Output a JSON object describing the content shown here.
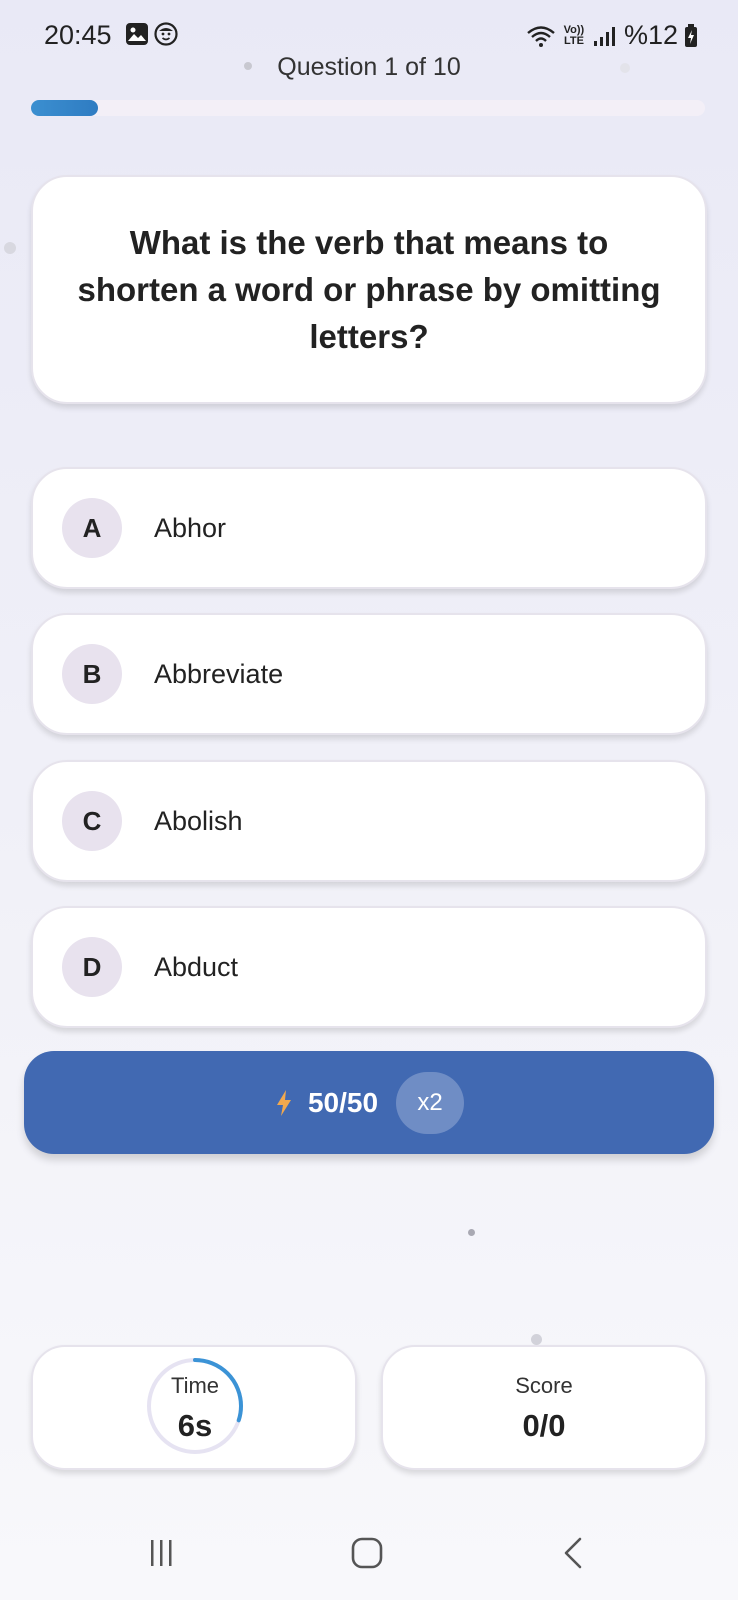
{
  "status_bar": {
    "time": "20:45",
    "network": "Vo)) LTE",
    "battery": "%12"
  },
  "quiz": {
    "counter": "Question 1 of 10",
    "progress": 0.1,
    "question": "What is the verb that means to shorten a word or phrase by omitting letters?",
    "options": [
      {
        "letter": "A",
        "text": "Abhor"
      },
      {
        "letter": "B",
        "text": "Abbreviate"
      },
      {
        "letter": "C",
        "text": "Abolish"
      },
      {
        "letter": "D",
        "text": "Abduct"
      }
    ]
  },
  "lifeline": {
    "label": "50/50",
    "multiplier": "x2",
    "icon": "lightning-bolt-icon",
    "bolt_color": "#f2a94e"
  },
  "timer": {
    "label": "Time",
    "value": "6s",
    "remaining_fraction": 0.3
  },
  "score": {
    "label": "Score",
    "value": "0/0"
  },
  "colors": {
    "accent": "#4169b2",
    "progress": "#2f7cc2",
    "timer_ring": "#3b93d6"
  },
  "nav": {
    "recent_icon": "recent-apps-icon",
    "home_icon": "home-icon",
    "back_icon": "back-icon"
  }
}
